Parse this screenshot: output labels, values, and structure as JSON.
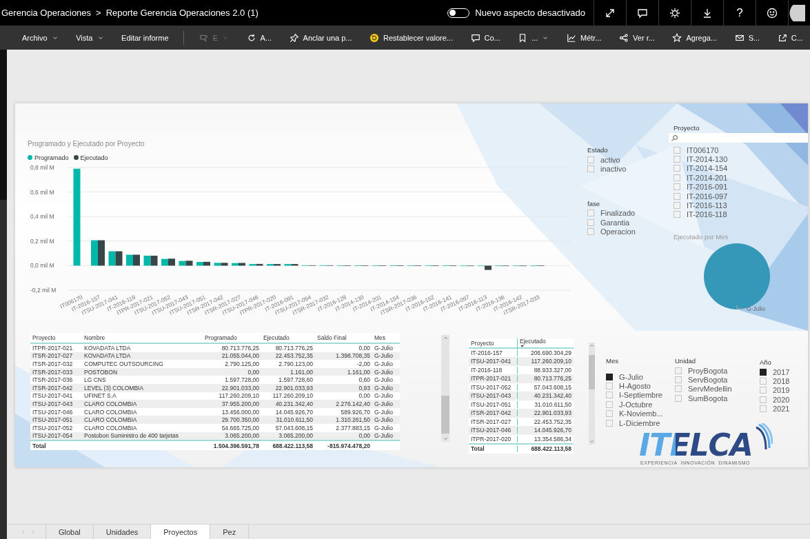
{
  "breadcrumb": {
    "workspace": "Gerencia Operaciones",
    "separator": ">",
    "report": "Reporte Gerencia Operaciones 2.0 (1)"
  },
  "appearance_toggle": {
    "label": "Nuevo aspecto desactivado",
    "on": false
  },
  "header_buttons": [
    {
      "kind": "expand"
    },
    {
      "kind": "comment"
    },
    {
      "kind": "settings"
    },
    {
      "kind": "download"
    },
    {
      "kind": "help",
      "text": "?"
    },
    {
      "kind": "feedback"
    },
    {
      "kind": "avatar"
    }
  ],
  "toolbar": [
    {
      "label": "Archivo",
      "kind": "text",
      "dropdown": true,
      "disabled": false
    },
    {
      "label": "Vista",
      "kind": "text",
      "dropdown": true,
      "disabled": false
    },
    {
      "label": "Editar informe",
      "kind": "text",
      "dropdown": false,
      "disabled": false
    },
    {
      "label": "E",
      "kind": "view",
      "dropdown": true,
      "disabled": true
    },
    {
      "label": "A...",
      "kind": "refresh",
      "dropdown": false,
      "disabled": false
    },
    {
      "label": "Anclar una p...",
      "kind": "pin",
      "dropdown": false,
      "disabled": false
    },
    {
      "label": "Restablecer valore...",
      "kind": "reset",
      "dropdown": false,
      "disabled": false
    },
    {
      "label": "Co...",
      "kind": "comment",
      "dropdown": false,
      "disabled": false
    },
    {
      "label": "...",
      "kind": "bookmark",
      "dropdown": true,
      "disabled": false
    },
    {
      "label": "Métr...",
      "kind": "linechart",
      "dropdown": false,
      "disabled": false
    },
    {
      "label": "Ver r...",
      "kind": "nodes",
      "dropdown": false,
      "disabled": false
    },
    {
      "label": "Agrega...",
      "kind": "star",
      "dropdown": false,
      "disabled": false
    },
    {
      "label": "S...",
      "kind": "mail",
      "dropdown": false,
      "disabled": false
    },
    {
      "label": "C...",
      "kind": "export",
      "dropdown": false,
      "disabled": false
    }
  ],
  "bar_chart": {
    "chart_data": {
      "type": "bar",
      "title": "Programado y Ejecutado por Proyecto",
      "categories": [
        "IT006170",
        "IT-2016-157",
        "ITSU-2017-041",
        "IT-2016-118",
        "ITPR-2017-021",
        "ITSU-2017-052",
        "ITSU-2017-043",
        "ITSU-2017-051",
        "ITSR-2017-042",
        "ITSR-2017-027",
        "ITSU-2017-046",
        "ITPR-2017-020",
        "IT-2016-091",
        "ITSU-2017-054",
        "ITSR-2017-032",
        "IT-2016-128",
        "IT-2014-130",
        "IT-2014-201",
        "IT-2014-154",
        "ITSR-2017-036",
        "IT-2016-152",
        "IT-2016-141",
        "IT-2016-097",
        "IT-2016-113",
        "IT-2016-136",
        "IT-2016-142",
        "ITSR-2017-033"
      ],
      "series": [
        {
          "name": "Programado",
          "color": "#01b8aa",
          "values": [
            0.79,
            0.207,
            0.117,
            0.089,
            0.081,
            0.055,
            0.038,
            0.03,
            0.023,
            0.021,
            0.013,
            0.013,
            0.013,
            0.003,
            0.003,
            0.002,
            0.002,
            0.002,
            0.002,
            0.002,
            0.002,
            0.002,
            0,
            0,
            0,
            0,
            0
          ]
        },
        {
          "name": "Ejecutado",
          "color": "#374649",
          "values": [
            null,
            0.207,
            0.117,
            0.089,
            0.081,
            0.057,
            0.04,
            0.031,
            0.023,
            0.022,
            0.014,
            0.013,
            0.013,
            0.003,
            0.003,
            0.002,
            0.002,
            0.002,
            0.002,
            0.002,
            0.002,
            0.002,
            -0.003,
            -0.035,
            0,
            -0.002,
            0.002
          ]
        }
      ],
      "ylim": [
        -0.2,
        0.8
      ],
      "grid": true,
      "legend": "top-left",
      "yticks": [
        {
          "value": 0.8,
          "label": "0,8 mil M"
        },
        {
          "value": 0.6,
          "label": "0,6 mil M"
        },
        {
          "value": 0.4,
          "label": "0,4 mil M"
        },
        {
          "value": 0.2,
          "label": "0,2 mil M"
        },
        {
          "value": 0,
          "label": "0,0 mil M"
        },
        {
          "value": -0.2,
          "label": "-0,2 mil M"
        }
      ]
    }
  },
  "estado_slicer": {
    "title": "Estado",
    "items": [
      {
        "label": "activo",
        "checked": false
      },
      {
        "label": "inactivo",
        "checked": false
      }
    ]
  },
  "fase_slicer": {
    "title": "fase",
    "items": [
      {
        "label": "Finalizado",
        "checked": false
      },
      {
        "label": "Garantia",
        "checked": false
      },
      {
        "label": "Operacion",
        "checked": false
      }
    ]
  },
  "proyecto_slicer": {
    "title": "Proyecto",
    "items": [
      {
        "label": "IT006170",
        "checked": false
      },
      {
        "label": "IT-2014-130",
        "checked": false
      },
      {
        "label": "IT-2014-154",
        "checked": false
      },
      {
        "label": "IT-2014-201",
        "checked": false
      },
      {
        "label": "IT-2016-091",
        "checked": false
      },
      {
        "label": "IT-2016-097",
        "checked": false
      },
      {
        "label": "IT-2016-113",
        "checked": false
      },
      {
        "label": "IT-2016-118",
        "checked": false
      }
    ]
  },
  "pie_chart": {
    "chart_data": {
      "type": "pie",
      "title": "Ejecutado por Mes",
      "categories": [
        "G-Julio"
      ],
      "values": [
        100
      ]
    }
  },
  "detail_table": {
    "columns": [
      {
        "label": "Proyecto",
        "kind": "text"
      },
      {
        "label": "Nombre",
        "kind": "text"
      },
      {
        "label": "Programado",
        "kind": "number"
      },
      {
        "label": "Ejecutado",
        "kind": "number"
      },
      {
        "label": "Saldo Final",
        "kind": "number"
      },
      {
        "label": "Mes",
        "kind": "text"
      }
    ],
    "rows": [
      [
        "ITPR-2017-021",
        "KOVADATA LTDA",
        "80.713.776,25",
        "80.713.776,25",
        "0,00",
        "G-Julio"
      ],
      [
        "ITSR-2017-027",
        "KOVADATA LTDA",
        "21.055.044,00",
        "22.453.752,35",
        "1.398.708,35",
        "G-Julio"
      ],
      [
        "ITSR-2017-032",
        "COMPUTEC OUTSOURCING",
        "2.790.125,00",
        "2.790.123,00",
        "-2,00",
        "G-Julio"
      ],
      [
        "ITSR-2017-033",
        "POSTOBON",
        "0,00",
        "1.161,00",
        "1.161,00",
        "G-Julio"
      ],
      [
        "ITSR-2017-036",
        "LG CNS",
        "1.597.728,00",
        "1.597.728,60",
        "0,60",
        "G-Julio"
      ],
      [
        "ITSR-2017-042",
        "LEVEL (3) COLOMBIA",
        "22.901.033,00",
        "22.901.033,93",
        "0,93",
        "G-Julio"
      ],
      [
        "ITSU-2017-041",
        "UFINET S.A",
        "117.260.209,10",
        "117.260.209,10",
        "0,00",
        "G-Julio"
      ],
      [
        "ITSU-2017-043",
        "CLARO COLOMBIA",
        "37.955.200,00",
        "40.231.342,40",
        "2.276.142,40",
        "G-Julio"
      ],
      [
        "ITSU-2017-046",
        "CLARO COLOMBIA",
        "13.456.000,00",
        "14.045.926,70",
        "589.926,70",
        "G-Julio"
      ],
      [
        "ITSU-2017-051",
        "CLARO COLOMBIA",
        "29.700.350,00",
        "31.010.611,50",
        "1.310.261,50",
        "G-Julio"
      ],
      [
        "ITSU-2017-052",
        "CLARO COLOMBIA",
        "54.665.725,00",
        "57.043.608,15",
        "2.377.883,15",
        "G-Julio"
      ],
      [
        "ITSU-2017-054",
        "Postobon Suministro de 400 tarjetas",
        "3.065.200,00",
        "3.065.200,00",
        "0,00",
        "G-Julio"
      ]
    ],
    "total": {
      "label": "Total",
      "cells": [
        "1.504.396.591,78",
        "688.422.113,58",
        "-815.974.478,20"
      ]
    }
  },
  "ranking_table": {
    "columns": [
      {
        "label": "Proyecto",
        "kind": "text",
        "sorted": false
      },
      {
        "label": "Ejecutado",
        "kind": "number",
        "sorted": true
      }
    ],
    "rows": [
      [
        "IT-2016-157",
        "206.690.304,29"
      ],
      [
        "ITSU-2017-041",
        "117.260.209,10"
      ],
      [
        "IT-2016-118",
        "88.933.327,00"
      ],
      [
        "ITPR-2017-021",
        "80.713.776,25"
      ],
      [
        "ITSU-2017-052",
        "57.043.608,15"
      ],
      [
        "ITSU-2017-043",
        "40.231.342,40"
      ],
      [
        "ITSU-2017-051",
        "31.010.611,50"
      ],
      [
        "ITSR-2017-042",
        "22.901.033,93"
      ],
      [
        "ITSR-2017-027",
        "22.453.752,35"
      ],
      [
        "ITSU-2017-046",
        "14.045.926,70"
      ],
      [
        "ITPR-2017-020",
        "13.354.586,34"
      ]
    ],
    "total": {
      "label": "Total",
      "cells": [
        "688.422.113,58"
      ]
    }
  },
  "mes_slicer": {
    "title": "Mes",
    "items": [
      {
        "label": "G-Julio",
        "checked": true
      },
      {
        "label": "H-Agosto",
        "checked": false
      },
      {
        "label": "I-Septiembre",
        "checked": false
      },
      {
        "label": "J-Octubre",
        "checked": false
      },
      {
        "label": "K-Noviemb...",
        "checked": false
      },
      {
        "label": "L-Diciembre",
        "checked": false
      }
    ]
  },
  "unidad_slicer": {
    "title": "Unidad",
    "items": [
      {
        "label": "ProyBogota",
        "checked": false
      },
      {
        "label": "ServBogota",
        "checked": false
      },
      {
        "label": "ServMedellin",
        "checked": false
      },
      {
        "label": "SumBogota",
        "checked": false
      }
    ]
  },
  "ano_slicer": {
    "title": "Año",
    "items": [
      {
        "label": "2017",
        "checked": true
      },
      {
        "label": "2018",
        "checked": false
      },
      {
        "label": "2019",
        "checked": false
      },
      {
        "label": "2020",
        "checked": false
      },
      {
        "label": "2021",
        "checked": false
      }
    ]
  },
  "logo": {
    "name": "ITELCA",
    "tagline": "EXPERIENCIA  INNOVACIÓN  DINAMISMO"
  },
  "page_tabs": [
    {
      "label": "Global",
      "selected": false
    },
    {
      "label": "Unidades",
      "selected": false
    },
    {
      "label": "Proyectos",
      "selected": true
    },
    {
      "label": "Pez",
      "selected": false
    }
  ]
}
